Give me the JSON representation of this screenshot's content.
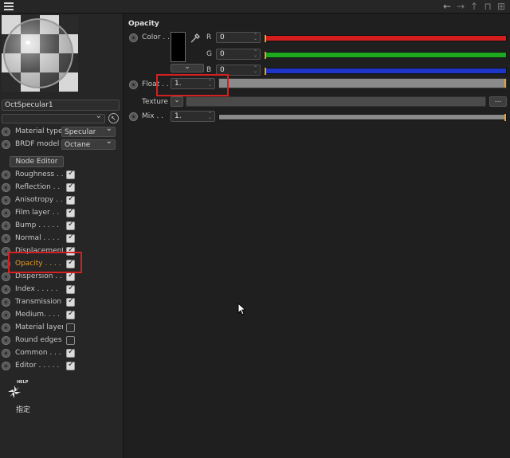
{
  "toolbar": {
    "menu_icon": "hamburger-icon",
    "nav_icons": [
      "back-arrow-icon",
      "forward-arrow-icon",
      "up-arrow-icon",
      "lock-icon",
      "new-window-icon"
    ]
  },
  "material": {
    "name": "OctSpecular1",
    "material_type_label": "Material type",
    "material_type_value": "Specular",
    "brdf_label": "BRDF model",
    "brdf_value": "Octane",
    "node_editor_label": "Node Editor"
  },
  "channels": [
    {
      "label": "Roughness . .",
      "checked": true
    },
    {
      "label": "Reflection . .",
      "checked": true
    },
    {
      "label": "Anisotropy . .",
      "checked": true
    },
    {
      "label": "Film layer . .",
      "checked": true
    },
    {
      "label": "Bump . . . . .",
      "checked": true
    },
    {
      "label": "Normal . . . .",
      "checked": true
    },
    {
      "label": "Displacement",
      "checked": true
    },
    {
      "label": "Opacity . . . .",
      "checked": true,
      "active": true
    },
    {
      "label": "Dispersion . .",
      "checked": true
    },
    {
      "label": "Index . . . . .",
      "checked": true
    },
    {
      "label": "Transmission",
      "checked": true
    },
    {
      "label": "Medium. . . .",
      "checked": true
    },
    {
      "label": "Material layer",
      "checked": false
    },
    {
      "label": "Round edges",
      "checked": false
    },
    {
      "label": "Common . . .",
      "checked": true
    },
    {
      "label": "Editor . . . . .",
      "checked": true
    }
  ],
  "help": {
    "icon": "octane-help-icon",
    "badge": "HELP",
    "label": "指定"
  },
  "opacity": {
    "title": "Opacity",
    "color_label": "Color . .",
    "r_label": "R",
    "g_label": "G",
    "b_label": "B",
    "r_value": "0",
    "g_value": "0",
    "b_value": "0",
    "float_label": "Float . .",
    "float_value": "1.",
    "texture_label": "Texture",
    "texture_dots": "...",
    "mix_label": "Mix . .",
    "mix_value": "1.",
    "colors": {
      "r": "#e02020",
      "g": "#20b020",
      "b": "#2040d0",
      "accent": "#f0a020",
      "highlight": "#d42020"
    }
  }
}
